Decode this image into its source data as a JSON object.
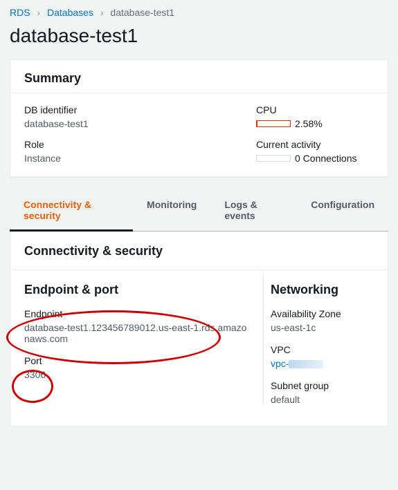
{
  "breadcrumb": {
    "root": "RDS",
    "databases": "Databases",
    "current": "database-test1"
  },
  "page_title": "database-test1",
  "summary": {
    "heading": "Summary",
    "db_identifier_label": "DB identifier",
    "db_identifier_value": "database-test1",
    "role_label": "Role",
    "role_value": "Instance",
    "cpu_label": "CPU",
    "cpu_value": "2.58%",
    "cpu_fill_pct": 3,
    "activity_label": "Current activity",
    "activity_value": "0 Connections"
  },
  "tabs": {
    "connectivity": "Connectivity & security",
    "monitoring": "Monitoring",
    "logs": "Logs & events",
    "configuration": "Configuration"
  },
  "conn": {
    "heading": "Connectivity & security",
    "ep_heading": "Endpoint & port",
    "endpoint_label": "Endpoint",
    "endpoint_value": "database-test1.123456789012.us-east-1.rds.amazonaws.com",
    "port_label": "Port",
    "port_value": "3306",
    "net_heading": "Networking",
    "az_label": "Availability Zone",
    "az_value": "us-east-1c",
    "vpc_label": "VPC",
    "vpc_value": "vpc-",
    "subnet_label": "Subnet group",
    "subnet_value": "default"
  }
}
